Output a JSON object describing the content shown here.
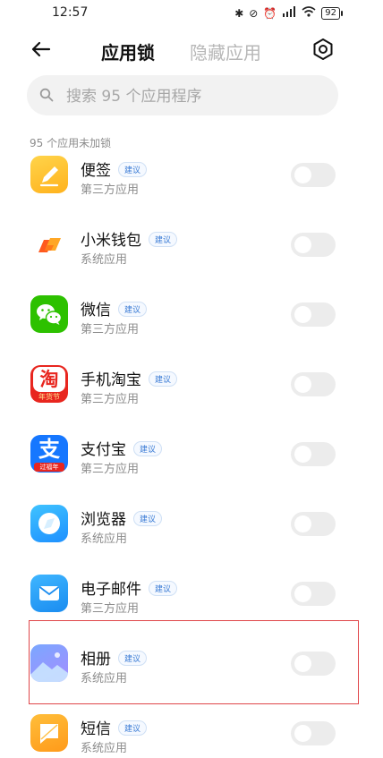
{
  "status_bar": {
    "time": "12:57",
    "battery": "92"
  },
  "header": {
    "tab_active": "应用锁",
    "tab_inactive": "隐藏应用"
  },
  "search": {
    "placeholder": "搜索 95 个应用程序"
  },
  "section": {
    "label": "95 个应用未加锁"
  },
  "apps": [
    {
      "name": "便签",
      "badge": "建议",
      "type": "第三方应用",
      "icon": "notes-icon",
      "locked": false
    },
    {
      "name": "小米钱包",
      "badge": "建议",
      "type": "系统应用",
      "icon": "mi-wallet-icon",
      "locked": false
    },
    {
      "name": "微信",
      "badge": "建议",
      "type": "第三方应用",
      "icon": "wechat-icon",
      "locked": false
    },
    {
      "name": "手机淘宝",
      "badge": "建议",
      "type": "第三方应用",
      "icon": "taobao-icon",
      "icon_text": "淘",
      "icon_subtext": "年货节",
      "locked": false
    },
    {
      "name": "支付宝",
      "badge": "建议",
      "type": "第三方应用",
      "icon": "alipay-icon",
      "icon_text": "支",
      "icon_subtext": "过福年",
      "locked": false
    },
    {
      "name": "浏览器",
      "badge": "建议",
      "type": "系统应用",
      "icon": "browser-icon",
      "locked": false
    },
    {
      "name": "电子邮件",
      "badge": "建议",
      "type": "第三方应用",
      "icon": "email-icon",
      "locked": false
    },
    {
      "name": "相册",
      "badge": "建议",
      "type": "系统应用",
      "icon": "gallery-icon",
      "locked": false
    },
    {
      "name": "短信",
      "badge": "建议",
      "type": "系统应用",
      "icon": "sms-icon",
      "locked": false
    }
  ],
  "colors": {
    "highlight": "#e0464a",
    "badge_text": "#3a7bd5",
    "toggle_off": "#ececec"
  }
}
